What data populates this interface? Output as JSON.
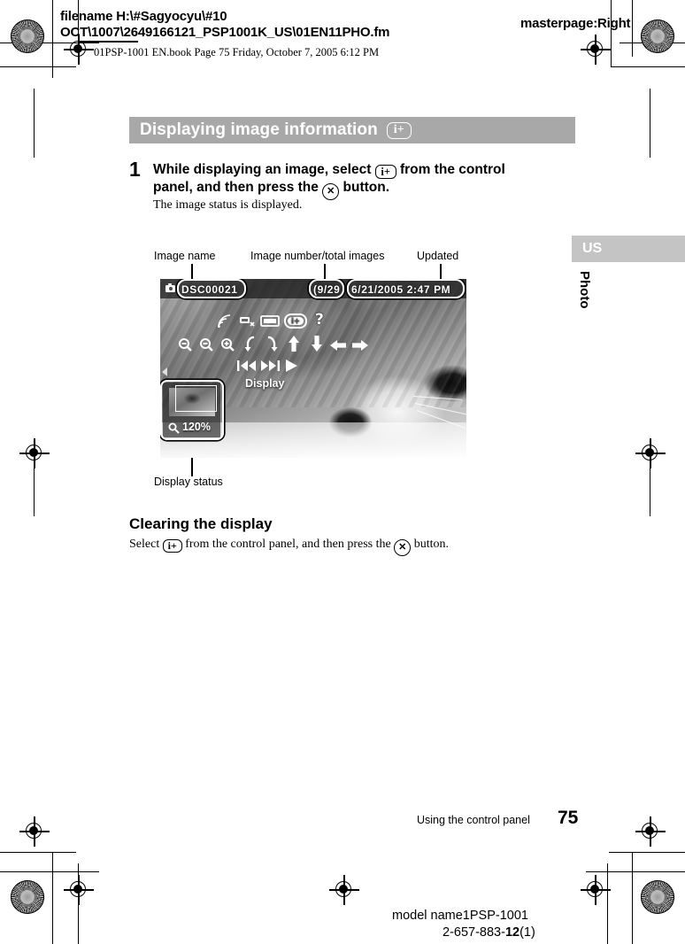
{
  "print_header": {
    "filename_line1": "filename H:\\#Sagyocyu\\#10",
    "filename_line2": "OCT\\1007\\2649166121_PSP1001K_US\\01EN11PHO.fm",
    "masterpage": "masterpage:Right",
    "book_line": "01PSP-1001 EN.book  Page 75  Friday, October 7, 2005  6:12 PM"
  },
  "section": {
    "title": "Displaying image information",
    "badge": "i+"
  },
  "step": {
    "number": "1",
    "text_part1": "While displaying an image, select",
    "badge": "i+",
    "text_part2": "from the control",
    "text_line2_part1": "panel, and then press the",
    "button_glyph": "✕",
    "text_line2_part2": "button.",
    "result": "The image status is displayed."
  },
  "callouts": {
    "image_name": "Image name",
    "image_number": "Image number/total images",
    "updated": "Updated",
    "display_status": "Display status"
  },
  "psp_screen": {
    "osd": {
      "image_name": "DSC00021",
      "image_number": "(9/29",
      "updated": "6/21/2005  2:47 PM"
    },
    "control_panel": {
      "row1": [
        {
          "name": "wireless-icon",
          "glyph": "≋"
        },
        {
          "name": "network-icon",
          "glyph": "▰"
        },
        {
          "name": "slideshow-icon",
          "glyph": "▤"
        },
        {
          "name": "image-info-icon",
          "glyph": "i+"
        },
        {
          "name": "help-icon",
          "glyph": "?"
        }
      ],
      "row2": [
        {
          "name": "zoom-reset-icon",
          "glyph": "⊖"
        },
        {
          "name": "zoom-out-icon",
          "glyph": "⊖"
        },
        {
          "name": "zoom-in-icon",
          "glyph": "⊕"
        },
        {
          "name": "rotate-left-icon",
          "glyph": "↺"
        },
        {
          "name": "rotate-right-icon",
          "glyph": "↻"
        },
        {
          "name": "pan-up-icon",
          "glyph": "↑"
        },
        {
          "name": "pan-down-icon",
          "glyph": "↓"
        },
        {
          "name": "pan-left-icon",
          "glyph": "←"
        },
        {
          "name": "pan-right-icon",
          "glyph": "→"
        }
      ],
      "row3": [
        {
          "name": "previous-icon",
          "glyph": "◄◄"
        },
        {
          "name": "next-icon",
          "glyph": "►►"
        },
        {
          "name": "play-icon",
          "glyph": "►"
        }
      ],
      "selected_label": "Display"
    },
    "display_status": {
      "zoom_level": "120%",
      "zoom_icon": "zoom-icon"
    }
  },
  "clearing": {
    "heading": "Clearing the display",
    "text_part1": "Select",
    "badge": "i+",
    "text_part2": "from the control panel, and then press the",
    "button_glyph": "✕",
    "text_part3": "button."
  },
  "side_tabs": {
    "region": "US",
    "chapter": "Photo"
  },
  "footer": {
    "running_head": "Using the control panel",
    "page_number": "75",
    "model_name": "model name1PSP-1001",
    "part_number_prefix": "2-657-883-",
    "part_number_bold": "12",
    "part_number_suffix": "(1)"
  }
}
